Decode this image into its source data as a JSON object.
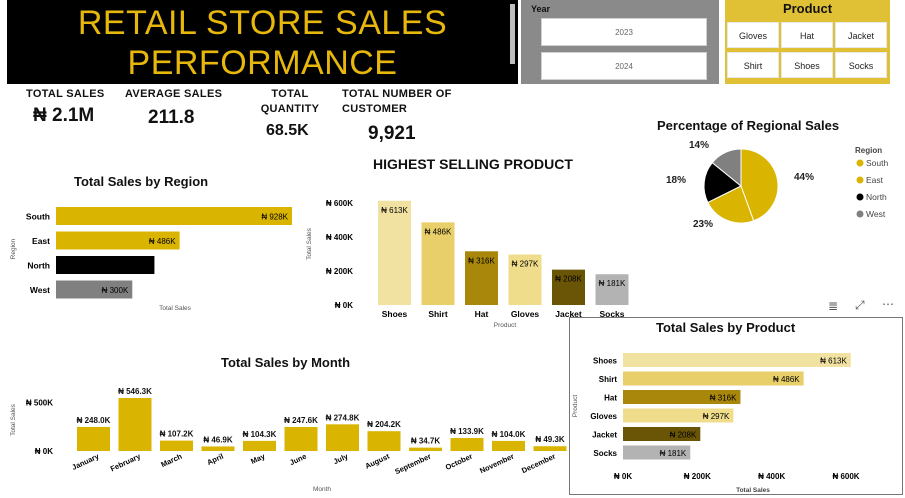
{
  "title": "RETAIL STORE SALES PERFORMANCE",
  "year_slicer": {
    "label": "Year",
    "options": [
      "2023",
      "2024"
    ]
  },
  "product_slicer": {
    "title": "Product",
    "options": [
      "Gloves",
      "Hat",
      "Jacket",
      "Shirt",
      "Shoes",
      "Socks"
    ]
  },
  "kpis": [
    {
      "label": "TOTAL SALES",
      "value": "₦ 2.1M"
    },
    {
      "label": "AVERAGE SALES",
      "value": "211.8"
    },
    {
      "label": "TOTAL QUANTITY",
      "value": "68.5K"
    },
    {
      "label": "TOTAL NUMBER OF CUSTOMER",
      "value": "9,921"
    }
  ],
  "toolbar": {
    "filter_icon": "filter-icon",
    "focus_icon": "focus-mode-icon",
    "more_icon": "more-options-icon"
  },
  "colors": {
    "gold": "#d9b400",
    "black": "#000000",
    "grey": "#7f7f7f",
    "title_gold": "#e7b80b"
  },
  "chart_data": [
    {
      "type": "bar",
      "orientation": "horizontal",
      "title": "Total Sales by Region",
      "xlabel": "Total Sales",
      "ylabel": "Region",
      "categories": [
        "South",
        "East",
        "North",
        "West"
      ],
      "values": [
        928,
        486,
        387,
        300
      ],
      "data_labels": [
        "₦ 928K",
        "₦ 486K",
        "₦ 387K",
        "₦ 300K"
      ],
      "colors": [
        "#d9b400",
        "#d9b400",
        "#000000",
        "#808080"
      ]
    },
    {
      "type": "bar",
      "title": "HIGHEST SELLING PRODUCT",
      "xlabel": "Product",
      "ylabel": "Total Sales",
      "categories": [
        "Shoes",
        "Shirt",
        "Hat",
        "Gloves",
        "Jacket",
        "Socks"
      ],
      "values": [
        613,
        486,
        316,
        297,
        208,
        181
      ],
      "data_labels": [
        "₦ 613K",
        "₦ 486K",
        "₦ 316K",
        "₦ 297K",
        "₦ 208K",
        "₦ 181K"
      ],
      "y_ticks": [
        "₦ 0K",
        "₦ 200K",
        "₦ 400K",
        "₦ 600K"
      ],
      "ylim": [
        0,
        600
      ],
      "colors": [
        "#f2e2a2",
        "#e8cf6a",
        "#a9870a",
        "#efdd8c",
        "#6a5506",
        "#b3b3b3"
      ]
    },
    {
      "type": "pie",
      "title": "Percentage of Regional Sales",
      "legend_title": "Region",
      "legend_position": "right",
      "labels": [
        "South",
        "East",
        "North",
        "West"
      ],
      "values": [
        44,
        23,
        18,
        14
      ],
      "data_labels": [
        "44%",
        "23%",
        "18%",
        "14%"
      ],
      "colors": [
        "#d9b400",
        "#d9b400",
        "#000000",
        "#808080"
      ]
    },
    {
      "type": "bar",
      "title": "Total Sales by Month",
      "xlabel": "Month",
      "ylabel": "Total Sales",
      "categories": [
        "January",
        "February",
        "March",
        "April",
        "May",
        "June",
        "July",
        "August",
        "September",
        "October",
        "November",
        "December"
      ],
      "values": [
        248.0,
        546.3,
        107.2,
        46.9,
        104.3,
        247.6,
        274.8,
        204.2,
        34.7,
        133.9,
        104.0,
        49.3
      ],
      "data_labels": [
        "₦ 248.0K",
        "₦ 546.3K",
        "₦ 107.2K",
        "₦ 46.9K",
        "₦ 104.3K",
        "₦ 247.6K",
        "₦ 274.8K",
        "₦ 204.2K",
        "₦ 34.7K",
        "₦ 133.9K",
        "₦ 104.0K",
        "₦ 49.3K"
      ],
      "y_ticks": [
        "₦ 0K",
        "₦ 500K"
      ],
      "ylim": [
        0,
        550
      ],
      "color": "#d9b400"
    },
    {
      "type": "bar",
      "orientation": "horizontal",
      "title": "Total Sales by Product",
      "xlabel": "Total Sales",
      "ylabel": "Product",
      "categories": [
        "Shoes",
        "Shirt",
        "Hat",
        "Gloves",
        "Jacket",
        "Socks"
      ],
      "values": [
        613,
        486,
        316,
        297,
        208,
        181
      ],
      "data_labels": [
        "₦ 613K",
        "₦ 486K",
        "₦ 316K",
        "₦ 297K",
        "₦ 208K",
        "₦ 181K"
      ],
      "x_ticks": [
        "₦ 0K",
        "₦ 200K",
        "₦ 400K",
        "₦ 600K"
      ],
      "xlim": [
        0,
        600
      ],
      "colors": [
        "#f2e2a2",
        "#e8cf6a",
        "#a9870a",
        "#efdd8c",
        "#6a5506",
        "#b3b3b3"
      ]
    }
  ]
}
